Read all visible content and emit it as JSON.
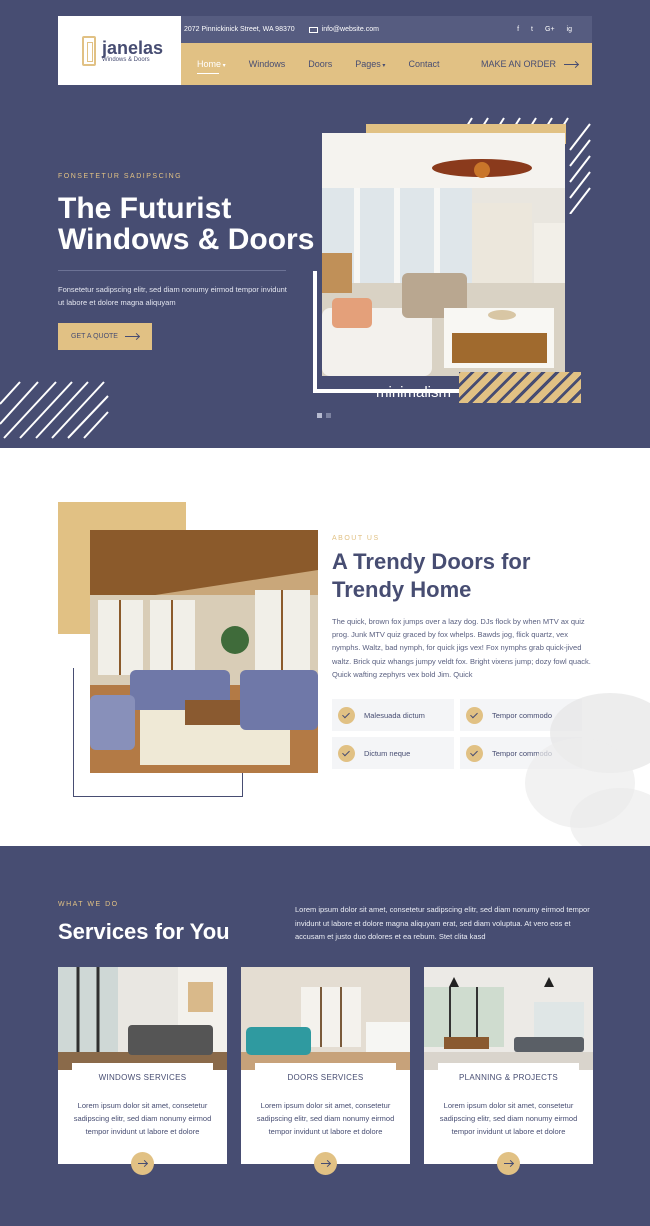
{
  "header": {
    "brand_name": "janelas",
    "brand_tagline": "Windows & Doors",
    "address": "2072 Pinnickinick Street, WA 98370",
    "email": "info@website.com",
    "socials": [
      "f",
      "t",
      "G+",
      "ig"
    ],
    "nav": [
      {
        "label": "Home"
      },
      {
        "label": "Windows"
      },
      {
        "label": "Doors"
      },
      {
        "label": "Pages"
      },
      {
        "label": "Contact"
      }
    ],
    "cta": "MAKE AN ORDER"
  },
  "hero": {
    "eyebrow": "FONSETETUR SADIPSCING",
    "title_line1": "The Futurist",
    "title_line2": "Windows & Doors",
    "text": "Fonsetetur sadipscing elitr, sed diam nonumy eirmod tempor invidunt ut labore et dolore magna aliquyam",
    "button": "GET A QUOTE",
    "caption": "minimalism",
    "slides": 2,
    "active_slide": 1
  },
  "about": {
    "eyebrow": "ABOUT US",
    "title_line1": "A Trendy Doors for",
    "title_line2": "Trendy Home",
    "text": "The quick, brown fox jumps over a lazy dog. DJs flock by when MTV ax quiz prog. Junk MTV quiz graced by fox whelps. Bawds jog, flick quartz, vex nymphs. Waltz, bad nymph, for quick jigs vex! Fox nymphs grab quick-jived waltz. Brick quiz whangs jumpy veldt fox. Bright vixens jump; dozy fowl quack. Quick wafting zephyrs vex bold Jim. Quick",
    "features": [
      "Malesuada dictum",
      "Tempor commodo",
      "Dictum neque",
      "Tempor commodo"
    ]
  },
  "services": {
    "eyebrow": "WHAT WE DO",
    "title": "Services for You",
    "text": "Lorem ipsum dolor sit amet, consetetur sadipscing elitr, sed diam nonumy eirmod tempor invidunt ut labore et dolore magna aliquyam erat, sed diam voluptua. At vero eos et accusam et justo duo dolores et ea rebum. Stet clita kasd",
    "cards": [
      {
        "title": "WINDOWS SERVICES",
        "text": "Lorem ipsum dolor sit amet, consetetur sadipscing elitr, sed diam nonumy eirmod tempor invidunt ut labore et dolore"
      },
      {
        "title": "DOORS SERVICES",
        "text": "Lorem ipsum dolor sit amet, consetetur sadipscing elitr, sed diam nonumy eirmod tempor invidunt ut labore et dolore"
      },
      {
        "title": "PLANNING & PROJECTS",
        "text": "Lorem ipsum dolor sit amet, consetetur sadipscing elitr, sed diam nonumy eirmod tempor invidunt ut labore et dolore"
      }
    ]
  },
  "colors": {
    "primary": "#474d72",
    "accent": "#e1c184",
    "white": "#ffffff"
  }
}
